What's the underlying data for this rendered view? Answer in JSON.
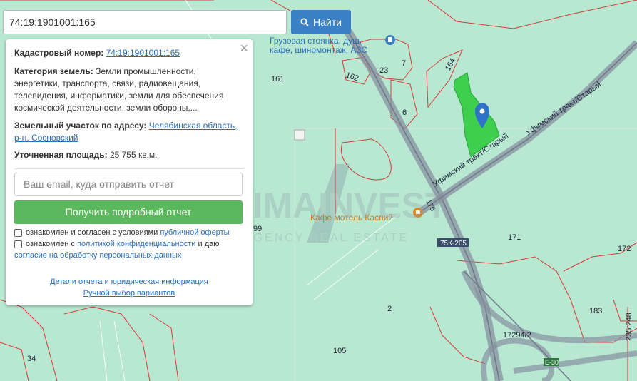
{
  "search": {
    "value": "74:19:1901001:165",
    "button_label": "Найти"
  },
  "panel": {
    "cadastral_label": "Кадастровый номер:",
    "cadastral_value": "74:19:1901001:165",
    "category_label": "Категория земель:",
    "category_text_1": "Земли промышленности,",
    "category_text_2": "энергетики, транспорта, связи, радиовещания,",
    "category_text_3": "телевидения, информатики, земли для обеспечения",
    "category_text_4": "космической деятельности, земли обороны,...",
    "address_label": "Земельный участок по адресу:",
    "address_link_1": "Челябинская область,",
    "address_link_2": "р-н. Сосновский",
    "area_label": "Уточненная площадь:",
    "area_value": "25 755 кв.м.",
    "email_placeholder": "Ваш email, куда отправить отчет",
    "report_button": "Получить подробный отчет",
    "consent1_text": "ознакомлен и согласен с условиями",
    "consent1_link": "публичной оферты",
    "consent2_text": "ознакомлен с",
    "consent2_link": "политикой конфиденциальности",
    "consent2_text2": "и даю",
    "consent2_link2": "согласие на обработку персональных данных",
    "details_link": "Детали отчета и юридическая информация",
    "manual_link": "Ручной выбор вариантов"
  },
  "map": {
    "poi1_line1": "Грузовая стоянка, душ,",
    "poi1_line2": "кафе, шиномонтаж, АЗС",
    "poi2": "Кафе мотель Каспий",
    "road_label_1": "Уфимский тракт/Старый",
    "road_label_2": "Уфимский тракт/Старый",
    "road_code": "75К-205",
    "road_num": "175",
    "e_road": "Е-30",
    "parcels": [
      "161",
      "162",
      "23",
      "7",
      "164",
      "6",
      "171",
      "172",
      "99",
      "2",
      "183",
      "17294/2",
      "235:248",
      "34",
      "105"
    ],
    "watermark_main": "PRIMAINVEST",
    "watermark_sub": "AGENCY REAL ESTATE"
  },
  "colors": {
    "map_bg": "#b8e8d2",
    "parcel_line": "#d63a3a",
    "highlight": "#3ecf4f",
    "accent": "#3b7fc4",
    "green_btn": "#5cb85c"
  }
}
